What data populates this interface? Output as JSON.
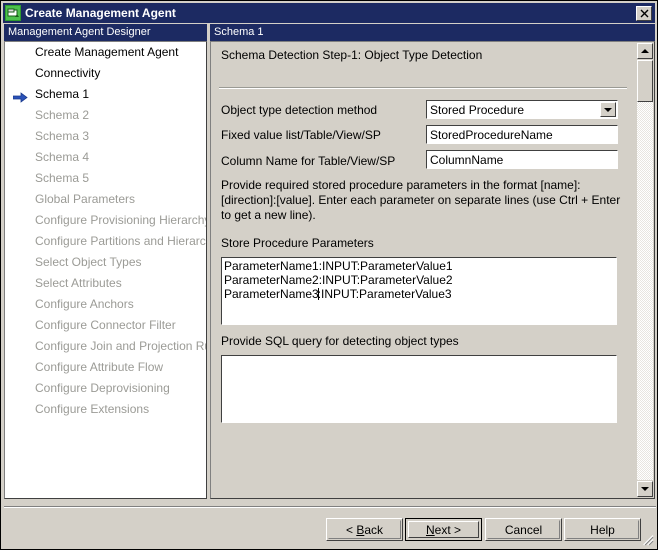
{
  "window": {
    "title": "Create Management Agent",
    "icon": "agent-icon",
    "close_label": "✕"
  },
  "panes": {
    "left_header": "Management Agent Designer",
    "right_header": "Schema 1"
  },
  "sidebar": {
    "items": [
      {
        "label": "Create Management Agent",
        "state": "done"
      },
      {
        "label": "Connectivity",
        "state": "done"
      },
      {
        "label": "Schema 1",
        "state": "current"
      },
      {
        "label": "Schema 2",
        "state": "disabled"
      },
      {
        "label": "Schema 3",
        "state": "disabled"
      },
      {
        "label": "Schema 4",
        "state": "disabled"
      },
      {
        "label": "Schema 5",
        "state": "disabled"
      },
      {
        "label": "Global Parameters",
        "state": "disabled"
      },
      {
        "label": "Configure Provisioning Hierarchy",
        "state": "disabled"
      },
      {
        "label": "Configure Partitions and Hierarchies",
        "state": "disabled"
      },
      {
        "label": "Select Object Types",
        "state": "disabled"
      },
      {
        "label": "Select Attributes",
        "state": "disabled"
      },
      {
        "label": "Configure Anchors",
        "state": "disabled"
      },
      {
        "label": "Configure Connector Filter",
        "state": "disabled"
      },
      {
        "label": "Configure Join and Projection Rules",
        "state": "disabled"
      },
      {
        "label": "Configure Attribute Flow",
        "state": "disabled"
      },
      {
        "label": "Configure Deprovisioning",
        "state": "disabled"
      },
      {
        "label": "Configure Extensions",
        "state": "disabled"
      }
    ]
  },
  "main": {
    "step_title": "Schema Detection Step-1:  Object Type Detection",
    "fields": {
      "detection_method_label": "Object type detection method",
      "detection_method_value": "Stored Procedure",
      "fixed_value_label": "Fixed value list/Table/View/SP",
      "fixed_value_value": "StoredProcedureName",
      "column_name_label": "Column Name for Table/View/SP",
      "column_name_value": "ColumnName"
    },
    "help_text": "Provide required stored procedure parameters in the format [name]:[direction]:[value]. Enter each parameter on separate lines (use Ctrl + Enter to get a new line).",
    "sp_params_label": "Store Procedure Parameters",
    "sp_params_lines": [
      "ParameterName1:INPUT:ParameterValue1",
      "ParameterName2:INPUT:ParameterValue2",
      "ParameterName3:INPUT:ParameterValue3"
    ],
    "sql_query_label": "Provide SQL query for detecting object types",
    "sql_query_value": ""
  },
  "buttons": {
    "back": {
      "prefix": "< ",
      "mnemonic": "B",
      "rest": "ack"
    },
    "next": {
      "prefix": "",
      "mnemonic": "N",
      "rest": "ext >"
    },
    "cancel": "Cancel",
    "help": "Help"
  },
  "colors": {
    "titlebar": "#1c2a62",
    "face": "#d4d0c8",
    "disabled_text": "#9b9b96",
    "arrow_blue": "#2b52b8"
  }
}
